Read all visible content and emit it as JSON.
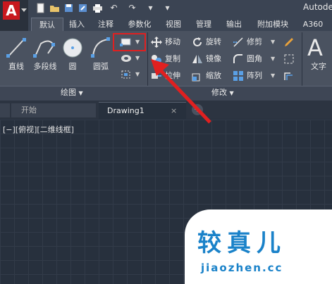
{
  "title_bar": {
    "app_title": "Autode"
  },
  "ribbon_tabs": [
    "默认",
    "插入",
    "注释",
    "参数化",
    "视图",
    "管理",
    "输出",
    "附加模块",
    "A360"
  ],
  "draw_panel": {
    "tools": [
      "直线",
      "多段线",
      "圆",
      "圆弧"
    ],
    "title": "绘图"
  },
  "modify_panel": {
    "commands": [
      {
        "label": "移动",
        "icon": "move-icon"
      },
      {
        "label": "旋转",
        "icon": "rotate-icon"
      },
      {
        "label": "修剪",
        "icon": "trim-icon"
      },
      {
        "label": "复制",
        "icon": "copy-icon"
      },
      {
        "label": "镜像",
        "icon": "mirror-icon"
      },
      {
        "label": "圆角",
        "icon": "fillet-icon"
      },
      {
        "label": "拉伸",
        "icon": "stretch-icon"
      },
      {
        "label": "缩放",
        "icon": "scale-icon"
      },
      {
        "label": "阵列",
        "icon": "array-icon"
      }
    ],
    "title": "修改"
  },
  "annotation": {
    "text_tool": "文字"
  },
  "doc_tabs": {
    "start": "开始",
    "drawing": "Drawing1",
    "close": "×",
    "add": "+"
  },
  "viewport": {
    "label": "[−][俯视][二维线框]"
  },
  "watermark": {
    "big": "较真儿",
    "small": "jiaozhen.cc"
  },
  "colors": {
    "highlight": "#e02020",
    "arrow": "#e02020",
    "app_red": "#c8181e"
  }
}
